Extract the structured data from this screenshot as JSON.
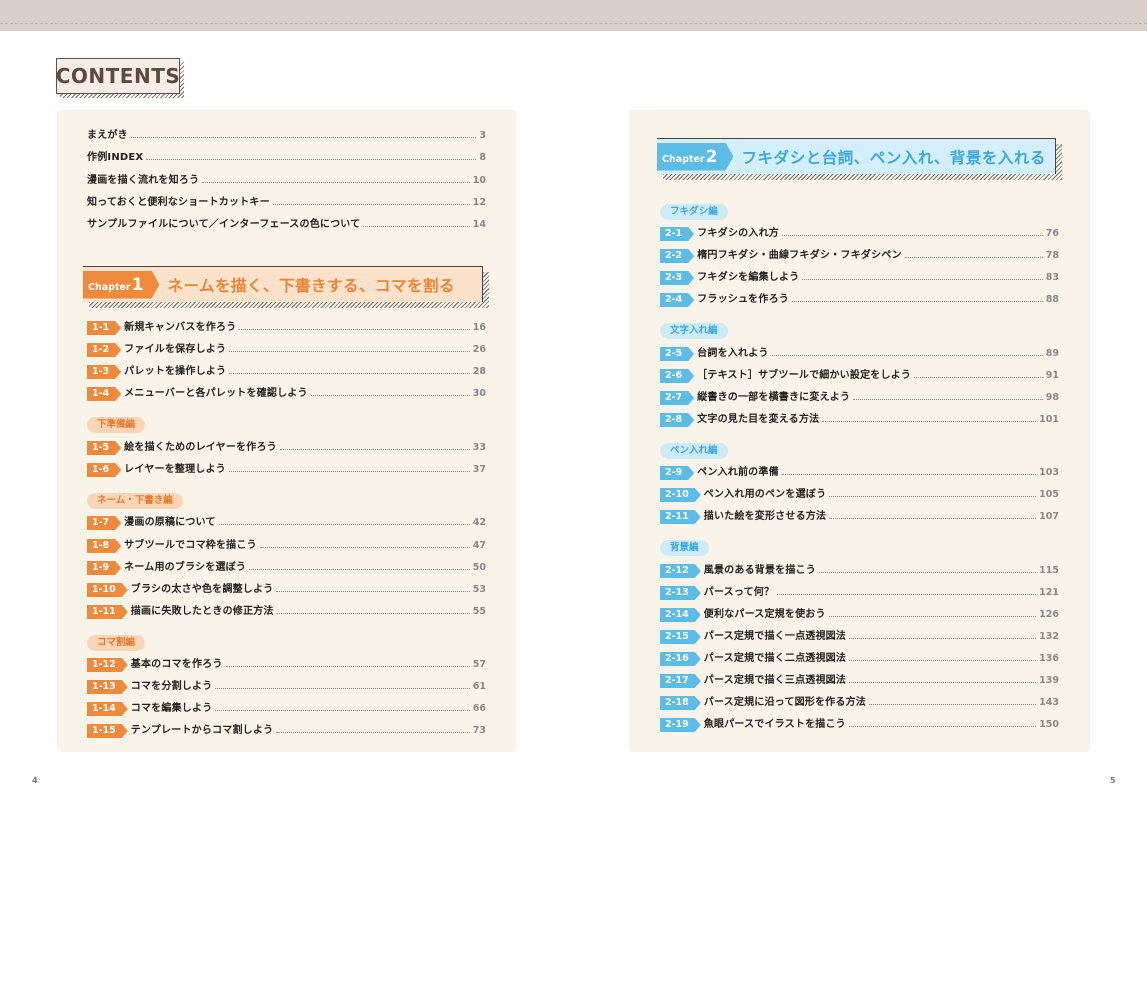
{
  "header": {
    "title": "CONTENTS"
  },
  "left_page": {
    "page_number": "4",
    "intro": [
      {
        "label": "まえがき",
        "page": "3"
      },
      {
        "label": "作例INDEX",
        "page": "8"
      },
      {
        "label": "漫画を描く流れを知ろう",
        "page": "10"
      },
      {
        "label": "知っておくと便利なショートカットキー",
        "page": "12"
      },
      {
        "label": "サンプルファイルについて／インターフェースの色について",
        "page": "14"
      }
    ],
    "chapter": {
      "word": "Chapter",
      "number": "1",
      "title": "ネームを描く、下書きする、コマを割る"
    },
    "sections": [
      {
        "tag": "",
        "entries": [
          {
            "num": "1-1",
            "label": "新規キャンバスを作ろう",
            "page": "16"
          },
          {
            "num": "1-2",
            "label": "ファイルを保存しよう",
            "page": "26"
          },
          {
            "num": "1-3",
            "label": "パレットを操作しよう",
            "page": "28"
          },
          {
            "num": "1-4",
            "label": "メニューバーと各パレットを確認しよう",
            "page": "30"
          }
        ]
      },
      {
        "tag": "下準備編",
        "entries": [
          {
            "num": "1-5",
            "label": "絵を描くためのレイヤーを作ろう",
            "page": "33"
          },
          {
            "num": "1-6",
            "label": "レイヤーを整理しよう",
            "page": "37"
          }
        ]
      },
      {
        "tag": "ネーム・下書き編",
        "entries": [
          {
            "num": "1-7",
            "label": "漫画の原稿について",
            "page": "42"
          },
          {
            "num": "1-8",
            "label": "サブツールでコマ枠を描こう",
            "page": "47"
          },
          {
            "num": "1-9",
            "label": "ネーム用のブラシを選ぼう",
            "page": "50"
          },
          {
            "num": "1-10",
            "label": "ブラシの太さや色を調整しよう",
            "page": "53"
          },
          {
            "num": "1-11",
            "label": "描画に失敗したときの修正方法",
            "page": "55"
          }
        ]
      },
      {
        "tag": "コマ割編",
        "entries": [
          {
            "num": "1-12",
            "label": "基本のコマを作ろう",
            "page": "57"
          },
          {
            "num": "1-13",
            "label": "コマを分割しよう",
            "page": "61"
          },
          {
            "num": "1-14",
            "label": "コマを編集しよう",
            "page": "66"
          },
          {
            "num": "1-15",
            "label": "テンプレートからコマ割しよう",
            "page": "73"
          }
        ]
      }
    ]
  },
  "right_page": {
    "page_number": "5",
    "chapter": {
      "word": "Chapter",
      "number": "2",
      "title": "フキダシと台詞、ペン入れ、背景を入れる"
    },
    "sections": [
      {
        "tag": "フキダシ編",
        "entries": [
          {
            "num": "2-1",
            "label": "フキダシの入れ方",
            "page": "76"
          },
          {
            "num": "2-2",
            "label": "楕円フキダシ・曲線フキダシ・フキダシペン",
            "page": "78"
          },
          {
            "num": "2-3",
            "label": "フキダシを編集しよう",
            "page": "83"
          },
          {
            "num": "2-4",
            "label": "フラッシュを作ろう",
            "page": "88"
          }
        ]
      },
      {
        "tag": "文字入れ編",
        "entries": [
          {
            "num": "2-5",
            "label": "台詞を入れよう",
            "page": "89"
          },
          {
            "num": "2-6",
            "label": "［テキスト］サブツールで細かい設定をしよう",
            "page": "91"
          },
          {
            "num": "2-7",
            "label": "縦書きの一部を横書きに変えよう",
            "page": "98"
          },
          {
            "num": "2-8",
            "label": "文字の見た目を変える方法",
            "page": "101"
          }
        ]
      },
      {
        "tag": "ペン入れ編",
        "entries": [
          {
            "num": "2-9",
            "label": "ペン入れ前の準備",
            "page": "103"
          },
          {
            "num": "2-10",
            "label": "ペン入れ用のペンを選ぼう",
            "page": "105"
          },
          {
            "num": "2-11",
            "label": "描いた絵を変形させる方法",
            "page": "107"
          }
        ]
      },
      {
        "tag": "背景編",
        "entries": [
          {
            "num": "2-12",
            "label": "風景のある背景を描こう",
            "page": "115"
          },
          {
            "num": "2-13",
            "label": "パースって何？",
            "page": "121"
          },
          {
            "num": "2-14",
            "label": "便利なパース定規を使おう",
            "page": "126"
          },
          {
            "num": "2-15",
            "label": "パース定規で描く一点透視図法",
            "page": "132"
          },
          {
            "num": "2-16",
            "label": "パース定規で描く二点透視図法",
            "page": "136"
          },
          {
            "num": "2-17",
            "label": "パース定規で描く三点透視図法",
            "page": "139"
          },
          {
            "num": "2-18",
            "label": "パース定規に沿って図形を作る方法",
            "page": "143"
          },
          {
            "num": "2-19",
            "label": "魚眼パースでイラストを描こう",
            "page": "150"
          }
        ]
      }
    ]
  },
  "colors": {
    "chapter1_accent": "#ef8a3c",
    "chapter2_accent": "#5bbde6",
    "panel_bg": "#faf3e9"
  }
}
